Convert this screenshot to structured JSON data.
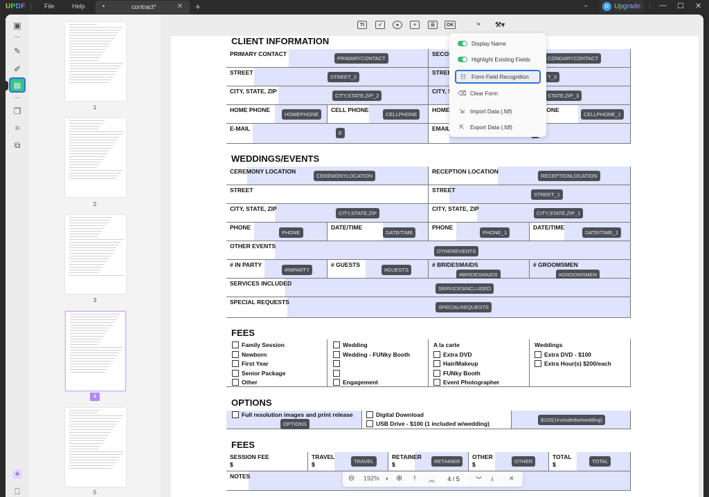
{
  "titlebar": {
    "logo": "UPDF",
    "menu": [
      "File",
      "Help"
    ],
    "tab": {
      "dot": "•",
      "name": "contract*",
      "close": "✕"
    },
    "add_tab": "+",
    "dropdown_chevron": "⌄",
    "user_initial": "R",
    "upgrade_label": "Upgrade",
    "window_controls": {
      "minimize": "—",
      "maximize": "☐",
      "close": "✕"
    }
  },
  "left_toolbar": {
    "icons": [
      "reader-icon",
      "comment-icon",
      "edit-icon",
      "form-icon",
      "organize-icon",
      "crop-icon",
      "convert-icon",
      "layers-icon",
      "bookmark-icon"
    ],
    "active": "form-icon"
  },
  "thumbnails": {
    "pages": [
      "1",
      "2",
      "3",
      "4",
      "5"
    ],
    "selected": "4"
  },
  "form_toolbar": {
    "tools": [
      {
        "name": "text-field-tool",
        "glyph": "TI"
      },
      {
        "name": "checkbox-tool",
        "glyph": "✓"
      },
      {
        "name": "radio-button-tool",
        "glyph": "●"
      },
      {
        "name": "combo-box-tool",
        "glyph": "≡"
      },
      {
        "name": "list-box-tool",
        "glyph": "☰"
      },
      {
        "name": "button-tool",
        "glyph": "OK"
      },
      {
        "name": "align-tool",
        "glyph": "⫶▾"
      },
      {
        "name": "form-tools-menu",
        "glyph": "⚒▾"
      }
    ]
  },
  "form_menu": {
    "items": [
      {
        "label": "Display Name",
        "type": "toggle",
        "on": true
      },
      {
        "label": "Highlight Existing Fields",
        "type": "toggle",
        "on": true
      },
      {
        "label": "Form Field Recognition",
        "type": "action",
        "icon": "☷",
        "active": true
      },
      {
        "label": "Clear Form",
        "type": "action",
        "icon": "⌫"
      },
      {
        "label": "Import Data (.fdf)",
        "type": "action",
        "icon": "⇲"
      },
      {
        "label": "Export Data (.fdf)",
        "type": "action",
        "icon": "⇱"
      }
    ]
  },
  "document": {
    "client_info": {
      "title": "CLIENT INFORMATION",
      "labels": {
        "primary_contact": "PRIMARY CONTACT",
        "secondary_contact": "SECON",
        "street": "STREET",
        "city": "CITY, STATE, ZIP",
        "city_right": "CITY, S",
        "home_phone": "HOME PHONE",
        "home_right": "HOME I",
        "cell_phone": "CELL PHONE",
        "cell_right": "L PHONE",
        "email": "E-MAIL",
        "email_right": "EMAIL"
      },
      "fields": {
        "primary_contact": "PRIMARYCONTACT",
        "secondary_contact": "CONDARYCONTACT",
        "street": "STREET_2",
        "street_right": "T_3",
        "city": "CITY,STATE,ZIP_2",
        "city_right": "STATE,ZIP_3",
        "home_phone": "HOMEPHONE",
        "cell_phone": "CELLPHONE",
        "cell_phone_right": "CELLPHONE_1",
        "email": "E",
        "email_right": "L"
      }
    },
    "weddings": {
      "title": "WEDDINGS/EVENTS",
      "labels": {
        "ceremony": "CEREMONY LOCATION",
        "reception": "RECEPTION LOCATION",
        "street": "STREET",
        "city": "CITY, STATE, ZIP",
        "phone": "PHONE",
        "datetime": "DATE/TIME",
        "other_events": "OTHER EVENTS",
        "in_party": "# IN PARTY",
        "guests": "# GUESTS",
        "bridesmaids": "# BRIDESMAIDS",
        "groomsmen": "# GROOMSMEN",
        "services": "SERVICES INCLUDED",
        "special": "SPECIAL REQUESTS"
      },
      "fields": {
        "ceremony": "CEREMONYLOCATION",
        "reception": "RECEPTIONLOCATION",
        "street_right": "STREET_1",
        "city": "CITY,STATE,ZIP",
        "city_right": "CITY,STATE,ZIP_1",
        "phone": "PHONE",
        "datetime": "DATE/TIME",
        "phone_right": "PHONE_1",
        "datetime_right": "DATE/TIME_1",
        "other_events": "OTHEREVENTS",
        "in_party": "#INPARTY",
        "guests": "#GUESTS",
        "bridesmaids": "#BRIDESMAIDS",
        "groomsmen": "#GROOMSMEN",
        "services": "SERVICESINCLUDED",
        "special": "SPECIALREQUESTS"
      }
    },
    "fees": {
      "title": "FEES",
      "col1": [
        "Family Session",
        "Newborn",
        "First Year",
        "Senior Package",
        "Other"
      ],
      "col2": [
        "Wedding",
        "Wedding - FUNky Booth",
        "",
        "",
        "Engagement"
      ],
      "col3_header": "A la carte",
      "col3": [
        "Extra DVD",
        "Hair/Makeup",
        "FUNky Booth",
        "Event Photographer"
      ],
      "col4_header": "Weddings",
      "col4": [
        "Extra DVD - $100",
        "Extra Hour(s) $200/each"
      ]
    },
    "options": {
      "title": "OPTIONS",
      "full_res": "Full resolution images and print release",
      "options_field": "OPTIONS",
      "digital": "Digital Download",
      "usb": "USB Drive - $100 (1 included w/wedding)",
      "usb_field": "$100(1includedw/wedding)"
    },
    "fees2": {
      "title": "FEES",
      "columns": [
        {
          "label": "SESSION FEE",
          "currency": "$",
          "field": ""
        },
        {
          "label": "TRAVEL",
          "currency": "$",
          "field": "TRAVEL"
        },
        {
          "label": "RETAINER",
          "currency": "$",
          "field": "RETAINER"
        },
        {
          "label": "OTHER",
          "currency": "$",
          "field": "OTHER"
        },
        {
          "label": "TOTAL",
          "currency": "$",
          "field": "TOTAL"
        }
      ],
      "notes": "NOTES"
    }
  },
  "zoom_bar": {
    "zoom_out": "⊖",
    "zoom_level": "192%",
    "zoom_dropdown": "▾",
    "zoom_in": "⊕",
    "first_page": "⤒",
    "prev_page": "︽",
    "page_indicator": "4 / 5",
    "next_page": "︾",
    "last_page": "⤓",
    "close": "✕"
  }
}
